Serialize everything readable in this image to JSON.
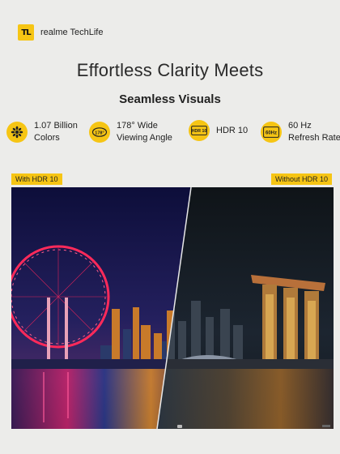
{
  "brand": {
    "logo_text": "TL",
    "name": "realme TechLife"
  },
  "headline": {
    "line1": "Effortless Clarity Meets",
    "line2": "Seamless Visuals"
  },
  "features": [
    {
      "icon": "color-palette-icon",
      "line1": "1.07 Billion",
      "line2": "Colors"
    },
    {
      "icon": "viewing-angle-icon",
      "badge": "178°",
      "line1": "178° Wide",
      "line2": "Viewing Angle"
    },
    {
      "icon": "hdr-icon",
      "badge": "HDR 10",
      "line1": "HDR 10",
      "line2": ""
    },
    {
      "icon": "refresh-rate-icon",
      "badge": "60Hz",
      "line1": "60 Hz",
      "line2": "Refresh Rate"
    }
  ],
  "comparison": {
    "left_label": "With HDR 10",
    "right_label": "Without HDR 10"
  },
  "colors": {
    "accent": "#f6c514",
    "background": "#ececea"
  }
}
